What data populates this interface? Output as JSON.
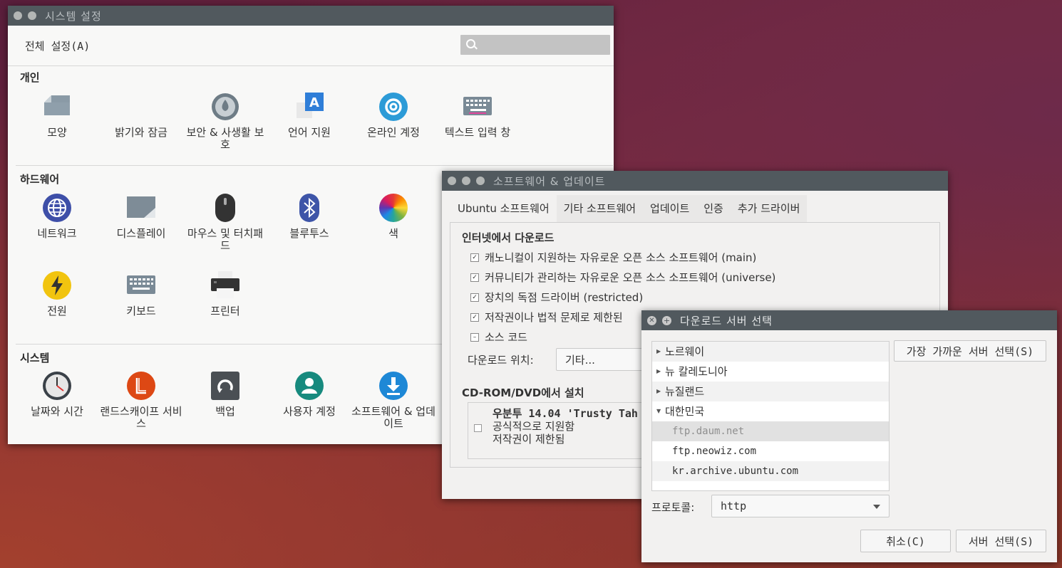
{
  "settings": {
    "title": "시스템 설정",
    "all_settings": "전체 설정(A)",
    "sections": {
      "personal": {
        "title": "개인",
        "items": [
          {
            "label": "모양",
            "icon": "appearance-icon"
          },
          {
            "label": "밝기와 잠금",
            "icon": "brightness-lock-icon"
          },
          {
            "label": "보안 & 사생활 보호",
            "icon": "security-privacy-icon"
          },
          {
            "label": "언어 지원",
            "icon": "language-icon"
          },
          {
            "label": "온라인 계정",
            "icon": "online-accounts-icon"
          },
          {
            "label": "텍스트 입력 창",
            "icon": "text-entry-icon"
          }
        ]
      },
      "hardware": {
        "title": "하드웨어",
        "items": [
          {
            "label": "네트워크",
            "icon": "network-icon"
          },
          {
            "label": "디스플레이",
            "icon": "display-icon"
          },
          {
            "label": "마우스 및 터치패드",
            "icon": "mouse-icon"
          },
          {
            "label": "블루투스",
            "icon": "bluetooth-icon"
          },
          {
            "label": "색",
            "icon": "color-icon"
          },
          {
            "label": "전원",
            "icon": "power-icon"
          },
          {
            "label": "키보드",
            "icon": "keyboard-icon"
          },
          {
            "label": "프린터",
            "icon": "printer-icon"
          }
        ]
      },
      "system": {
        "title": "시스템",
        "items": [
          {
            "label": "날짜와 시간",
            "icon": "clock-icon"
          },
          {
            "label": "랜드스캐이프 서비스",
            "icon": "landscape-icon"
          },
          {
            "label": "백업",
            "icon": "backup-icon"
          },
          {
            "label": "사용자 계정",
            "icon": "user-accounts-icon"
          },
          {
            "label": "소프트웨어 & 업데이트",
            "icon": "software-updates-icon"
          }
        ]
      }
    }
  },
  "software": {
    "title": "소프트웨어 & 업데이트",
    "tabs": [
      "Ubuntu 소프트웨어",
      "기타 소프트웨어",
      "업데이트",
      "인증",
      "추가 드라이버"
    ],
    "internet_heading": "인터넷에서 다운로드",
    "options": [
      {
        "label": "캐노니컬이 지원하는 자유로운 오픈 소스 소프트웨어 (main)",
        "checked": true
      },
      {
        "label": "커뮤니티가 관리하는 자유로운 오픈 소스 소프트웨어 (universe)",
        "checked": true
      },
      {
        "label": "장치의 독점 드라이버 (restricted)",
        "checked": true
      },
      {
        "label": "저작권이나 법적 문제로 제한된",
        "checked": true
      },
      {
        "label": "소스 코드",
        "checked": "partial"
      }
    ],
    "download_from_label": "다운로드 위치:",
    "download_from_value": "기타...",
    "cd_heading": "CD-ROM/DVD에서 설치",
    "cd_title": "우분투 14.04 'Trusty Tah",
    "cd_line1": "공식적으로 지원함",
    "cd_line2": "저작권이 제한됨"
  },
  "server_dialog": {
    "title": "다운로드 서버 선택",
    "countries": [
      {
        "label": "노르웨이",
        "expanded": false
      },
      {
        "label": "뉴 칼레도니아",
        "expanded": false
      },
      {
        "label": "뉴질랜드",
        "expanded": false
      },
      {
        "label": "대한민국",
        "expanded": true
      }
    ],
    "servers": [
      "ftp.daum.net",
      "ftp.neowiz.com",
      "kr.archive.ubuntu.com"
    ],
    "selected_server": "ftp.daum.net",
    "nearest_button": "가장 가까운 서버 선택(S)",
    "protocol_label": "프로토콜:",
    "protocol_value": "http",
    "cancel_button": "취소(C)",
    "select_button": "서버 선택(S)"
  },
  "colors": {
    "titlebar": "#51595e",
    "accent_blue": "#3a6fd6",
    "window_bg": "#f2f1f0"
  }
}
